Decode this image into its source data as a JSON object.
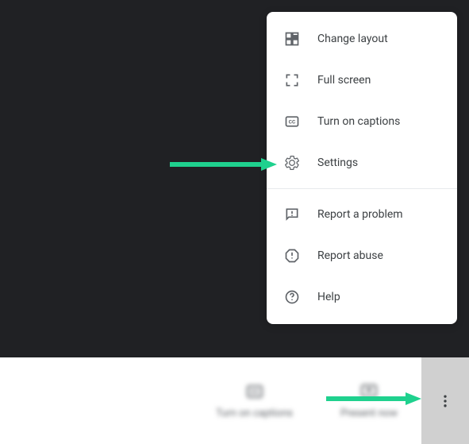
{
  "menu": {
    "items": [
      {
        "label": "Change layout",
        "icon": "layout-icon"
      },
      {
        "label": "Full screen",
        "icon": "fullscreen-icon"
      },
      {
        "label": "Turn on captions",
        "icon": "captions-icon"
      },
      {
        "label": "Settings",
        "icon": "settings-icon"
      },
      {
        "label": "Report a problem",
        "icon": "report-problem-icon"
      },
      {
        "label": "Report abuse",
        "icon": "report-abuse-icon"
      },
      {
        "label": "Help",
        "icon": "help-icon"
      }
    ]
  },
  "bottomBar": {
    "captions": "Turn on captions",
    "present": "Present now"
  },
  "annotation": {
    "arrowColor": "#1fd18e"
  }
}
